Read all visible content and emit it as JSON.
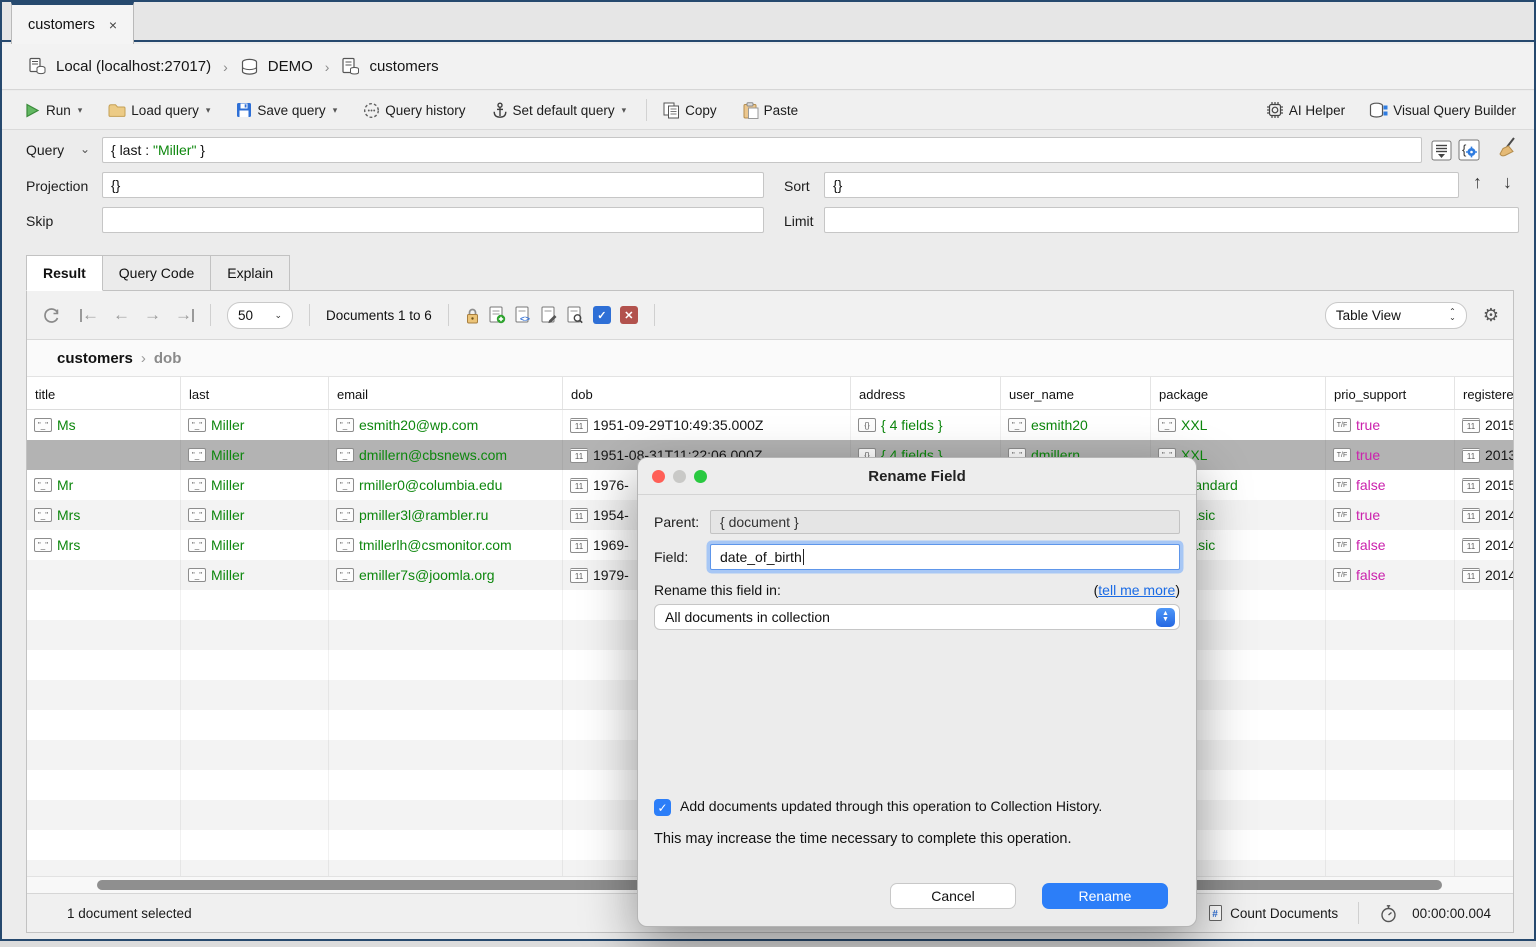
{
  "window": {
    "tab_label": "customers",
    "close_glyph": "×"
  },
  "breadcrumb": {
    "connection": "Local (localhost:27017)",
    "database": "DEMO",
    "collection": "customers"
  },
  "toolbar": {
    "run": "Run",
    "load_query": "Load query",
    "save_query": "Save query",
    "query_history": "Query history",
    "set_default_query": "Set default query",
    "copy": "Copy",
    "paste": "Paste",
    "ai_helper": "AI Helper",
    "visual_query_builder": "Visual Query Builder"
  },
  "query_panel": {
    "query_label": "Query",
    "query_prefix": "{ last : ",
    "query_string": "\"Miller\"",
    "query_suffix": " }",
    "projection_label": "Projection",
    "projection_value": "{}",
    "sort_label": "Sort",
    "sort_value": "{}",
    "skip_label": "Skip",
    "skip_value": "",
    "limit_label": "Limit",
    "limit_value": ""
  },
  "result_tabs": {
    "result": "Result",
    "query_code": "Query Code",
    "explain": "Explain"
  },
  "pagination": {
    "page_size": "50",
    "documents_label": "Documents 1 to 6",
    "view_mode": "Table View"
  },
  "table": {
    "path_collection": "customers",
    "path_field": "dob",
    "columns": [
      {
        "label": "title",
        "type": "string"
      },
      {
        "label": "last",
        "type": "string"
      },
      {
        "label": "email",
        "type": "string"
      },
      {
        "label": "dob",
        "type": "date"
      },
      {
        "label": "address",
        "type": "object"
      },
      {
        "label": "user_name",
        "type": "string"
      },
      {
        "label": "package",
        "type": "string"
      },
      {
        "label": "prio_support",
        "type": "bool"
      },
      {
        "label": "registered",
        "type": "date"
      }
    ],
    "rows": [
      [
        "Ms",
        "Miller",
        "esmith20@wp.com",
        "1951-09-29T10:49:35.000Z",
        "{ 4 fields }",
        "esmith20",
        "XXL",
        "true",
        "2015"
      ],
      [
        "",
        "Miller",
        "dmillern@cbsnews.com",
        "1951-08-31T11:22:06.000Z",
        "{ 4 fields }",
        "dmillern",
        "XXL",
        "true",
        "2013"
      ],
      [
        "Mr",
        "Miller",
        "rmiller0@columbia.edu",
        "1976-",
        "",
        "",
        "Standard",
        "false",
        "2015"
      ],
      [
        "Mrs",
        "Miller",
        "pmiller3l@rambler.ru",
        "1954-",
        "",
        "",
        "Basic",
        "true",
        "2014"
      ],
      [
        "Mrs",
        "Miller",
        "tmillerlh@csmonitor.com",
        "1969-",
        "",
        "",
        "Basic",
        "false",
        "2014"
      ],
      [
        "",
        "Miller",
        "emiller7s@joomla.org",
        "1979-",
        "",
        "",
        "",
        "false",
        "2014"
      ]
    ],
    "selected_row_index": 1
  },
  "dialog": {
    "title": "Rename Field",
    "parent_label": "Parent:",
    "parent_value": "{ document }",
    "field_label": "Field:",
    "field_value": "date_of_birth",
    "rename_in_label": "Rename this field in:",
    "tell_me_more_open": "(",
    "tell_me_more": "tell me more",
    "tell_me_more_close": ")",
    "scope_value": "All documents in collection",
    "checkbox_label": "Add documents updated through this operation to Collection History.",
    "note": "This may increase the time necessary to complete this operation.",
    "cancel": "Cancel",
    "rename": "Rename"
  },
  "status_bar": {
    "selection": "1 document selected",
    "count_documents": "Count Documents",
    "timer": "00:00:00.004"
  },
  "colors": {
    "accent_blue": "#2c7ef8",
    "string_green": "#0d870d",
    "bool_magenta": "#cb22ad",
    "selected_row_gray": "#b3b3b3",
    "window_border_navy": "#26496e"
  }
}
